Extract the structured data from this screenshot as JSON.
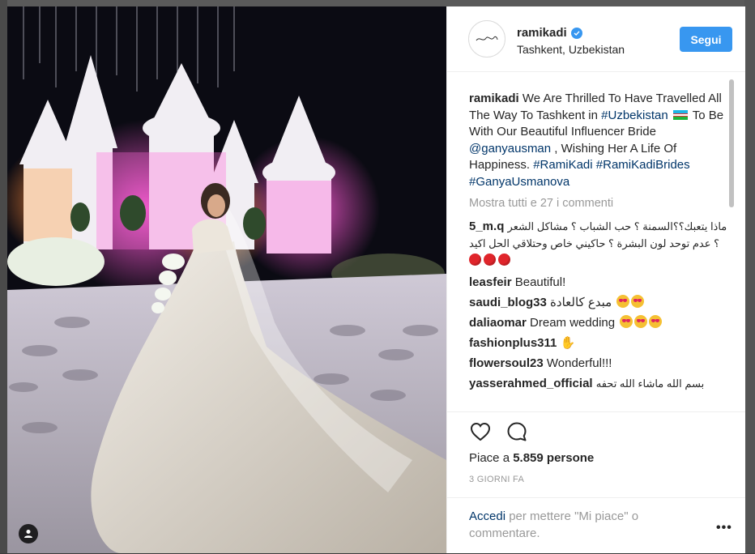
{
  "post": {
    "username": "ramikadi",
    "location": "Tashkent, Uzbekistan",
    "follow_label": "Segui",
    "caption_user": "ramikadi",
    "caption_parts": {
      "p1": "We Are Thrilled To Have Travelled All The Way To Tashkent in ",
      "tag_uzbekistan": "#Uzbekistan",
      "p2": " To Be With Our Beautiful Influencer Bride ",
      "mention": "@ganyausman",
      "p3": " , Wishing Her A Life Of Happiness. ",
      "tag_ramikadi": "#RamiKadi",
      "tag_brides": "#RamiKadiBrides",
      "tag_ganya": "#GanyaUsmanova"
    },
    "show_all_comments": "Mostra tutti e 27 i commenti",
    "likes_prefix": "Piace a ",
    "likes_count": "5.859 persone",
    "time_ago": "3 GIORNI FA",
    "login_link": "Accedi",
    "login_rest": " per mettere \"Mi piace\" o commentare.",
    "more_options": "•••"
  },
  "comments": [
    {
      "user": "5_m.q",
      "text": "ماذا يتعبك؟؟السمنة ؟ حب الشباب ؟ مشاكل الشعر ؟ عدم توحد لون البشرة ؟ حاكيني خاص وحتلاقي الحل اكيد",
      "suffix_icon": "red-circle-x3"
    },
    {
      "user": "leasfeir",
      "text": "Beautiful!"
    },
    {
      "user": "saudi_blog33",
      "text": "مبدع كالعادة",
      "suffix_icon": "heart-eyes-x2"
    },
    {
      "user": "daliaomar",
      "text": "Dream wedding",
      "suffix_icon": "heart-eyes-x3"
    },
    {
      "user": "fashionplus311",
      "text": "",
      "suffix_icon": "ok-hand"
    },
    {
      "user": "flowersoul23",
      "text": "Wonderful!!!"
    },
    {
      "user": "yasserahmed_official",
      "text": "بسم الله ماشاء الله تحفه"
    }
  ],
  "colors": {
    "accent_blue": "#3897f0",
    "link_blue": "#003569",
    "muted_gray": "#999999"
  },
  "icons": [
    "verified-badge-icon",
    "heart-icon",
    "comment-icon",
    "user-tag-icon"
  ]
}
